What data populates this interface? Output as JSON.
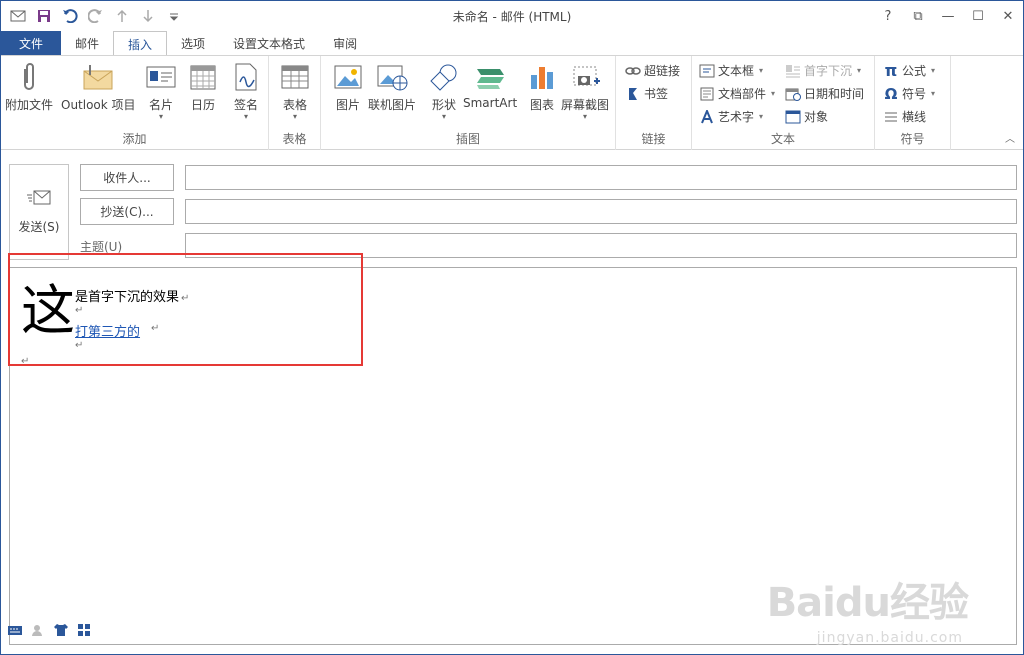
{
  "window": {
    "title": "未命名 - 邮件 (HTML)",
    "controls": [
      "?",
      "⧉",
      "—",
      "☐",
      "✕"
    ]
  },
  "qat": [
    "outlook-icon",
    "save-icon",
    "undo-icon",
    "redo-icon",
    "up-icon",
    "down-icon",
    "customize-icon"
  ],
  "tabs": [
    {
      "label": "文件"
    },
    {
      "label": "邮件"
    },
    {
      "label": "插入"
    },
    {
      "label": "选项"
    },
    {
      "label": "设置文本格式"
    },
    {
      "label": "审阅"
    }
  ],
  "ribbon": {
    "groups": {
      "add": {
        "label": "添加",
        "attach_file": "附加文件",
        "outlook_item": "Outlook 项目",
        "business_card": "名片",
        "calendar": "日历",
        "signature": "签名"
      },
      "tables": {
        "label": "表格",
        "table": "表格"
      },
      "illustrations": {
        "label": "插图",
        "pictures": "图片",
        "online_pictures": "联机图片",
        "shapes": "形状",
        "smartart": "SmartArt",
        "chart": "图表",
        "screenshot": "屏幕截图"
      },
      "links": {
        "label": "链接",
        "hyperlink": "超链接",
        "bookmark": "书签"
      },
      "text": {
        "label": "文本",
        "textbox": "文本框",
        "quick_parts": "文档部件",
        "wordart": "艺术字",
        "drop_cap": "首字下沉",
        "date_time": "日期和时间",
        "object": "对象"
      },
      "symbols": {
        "label": "符号",
        "equation": "公式",
        "symbol": "符号",
        "horizontal_line": "横线"
      }
    }
  },
  "compose": {
    "send": "发送(S)",
    "to": "收件人...",
    "cc": "抄送(C)...",
    "subject": "主题(U)"
  },
  "body": {
    "drop_cap": "这",
    "line1": "是首字下沉的效果",
    "link": "打第三方的 ",
    "para_mark": "↵"
  },
  "watermark": {
    "brand": "Baidu经验",
    "url": "jingyan.baidu.com"
  },
  "colors": {
    "accent": "#2b579a",
    "highlight": "#e53935",
    "link": "#1f57b4"
  }
}
